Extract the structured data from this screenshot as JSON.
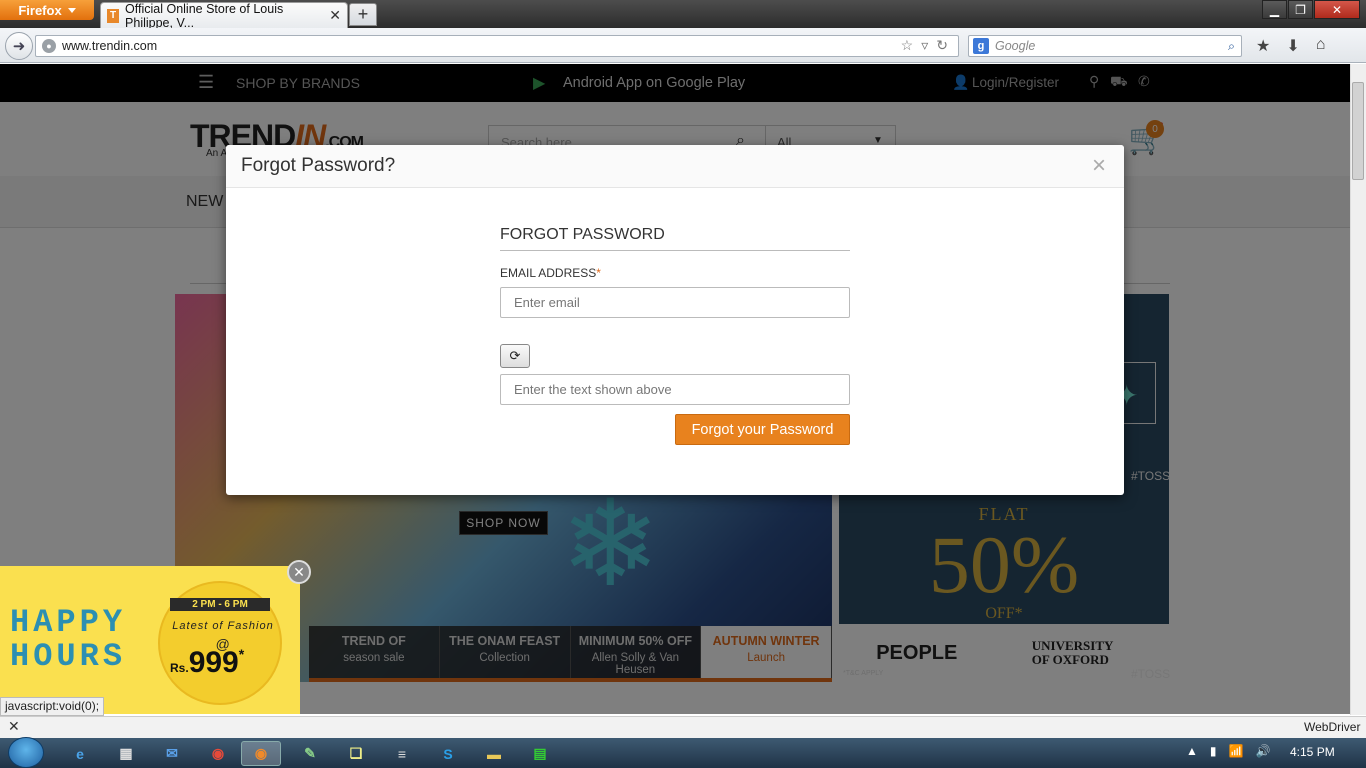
{
  "browser": {
    "menu_button": "Firefox",
    "tab_title": "Official Online Store of Louis Philippe, V...",
    "tab_favicon": "T",
    "url": "www.trendin.com",
    "search_engine_placeholder": "Google"
  },
  "site": {
    "topbar": {
      "shop_by_brands": "SHOP BY BRANDS",
      "android_app": "Android App on Google Play",
      "login": "Login/Register"
    },
    "logo": {
      "part1": "TREND",
      "part2": "IN",
      "part3": ".COM",
      "sub": "An A"
    },
    "search": {
      "placeholder": "Search here",
      "category": "All"
    },
    "cart_count": "0",
    "menu_first": "NEW",
    "banner": {
      "shop_now": "SHOP NOW",
      "flat": "FLAT",
      "percent": "50%",
      "off": "OFF*",
      "brand1": "PEOPLE",
      "brand2": "UNIVERSITY OF OXFORD",
      "tag": "#TOSS",
      "tc": "*T&C APPLY",
      "tabs": [
        {
          "title": "TREND OF",
          "sub": "season sale"
        },
        {
          "title": "THE ONAM FEAST",
          "sub": "Collection"
        },
        {
          "title": "MINIMUM 50% OFF",
          "sub": "Allen Solly & Van Heusen"
        },
        {
          "title": "AUTUMN WINTER",
          "sub": "Launch"
        }
      ]
    },
    "happy_hours": {
      "line1": "HAPPY",
      "line2": "HOURS",
      "time": "2 PM - 6 PM",
      "latest": "Latest of Fashion",
      "at": "@",
      "currency": "Rs.",
      "price": "999",
      "star": "*"
    }
  },
  "modal": {
    "title": "Forgot Password?",
    "close": "×",
    "section_title": "FORGOT PASSWORD",
    "email_label": "EMAIL ADDRESS",
    "required_mark": "*",
    "email_placeholder": "Enter email",
    "captcha_placeholder": "Enter the text shown above",
    "submit_label": "Forgot your Password"
  },
  "status_link": "javascript:void(0);",
  "findbar_label": "WebDriver",
  "taskbar": {
    "clock": "4:15 PM"
  }
}
